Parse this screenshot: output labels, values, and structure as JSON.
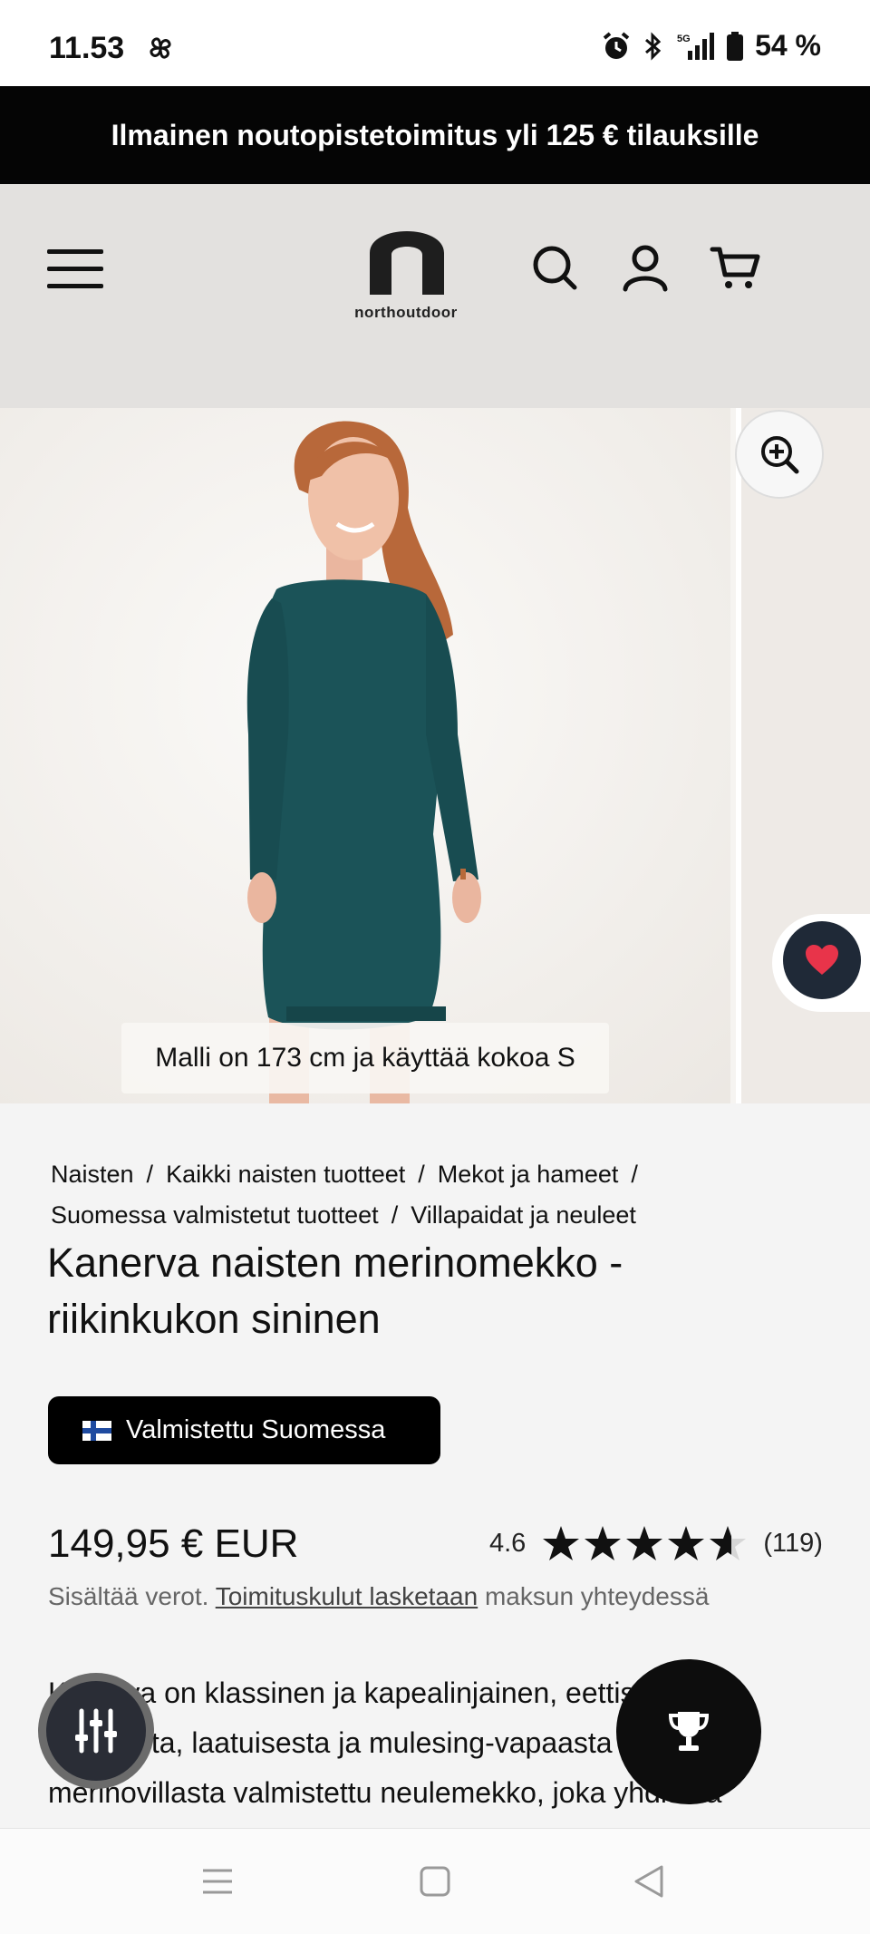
{
  "status_bar": {
    "time": "11.53",
    "network": "5G",
    "battery": "54 %",
    "icons": [
      "pinwheel-icon",
      "alarm-icon",
      "bluetooth-icon",
      "signal-icon",
      "battery-icon"
    ]
  },
  "promo_banner": {
    "text": "Ilmainen noutopistetoimitus yli 125 € tilauksille"
  },
  "header": {
    "logo_text": "northoutdoor",
    "icons": [
      "menu-icon",
      "search-icon",
      "account-icon",
      "cart-icon"
    ]
  },
  "gallery": {
    "caption": "Malli on 173 cm ja käyttää kokoa S",
    "dress_color": "#1b5358",
    "icons": [
      "zoom-in-icon",
      "heart-icon"
    ]
  },
  "breadcrumb": {
    "items": [
      "Naisten",
      "Kaikki naisten tuotteet",
      "Mekot ja hameet",
      "Suomessa valmistetut tuotteet",
      "Villapaidat ja neuleet"
    ]
  },
  "product": {
    "title_line1": "Kanerva naisten merinomekko -",
    "title_line2": "riikinkukon sininen",
    "badge": "Valmistettu Suomessa",
    "price": "149,95 € EUR",
    "rating_score": "4.6",
    "rating_stars": 4.6,
    "rating_count": "(119)",
    "tax_prefix": "Sisältää verot.",
    "tax_link": "Toimituskulut lasketaan",
    "tax_suffix": "maksun yhteydessä",
    "description_line1": "Kanerva on klassinen ja kapealinjainen, eettisesti",
    "description_line2": "tuotetusta, laatuisesta ja mulesing-vapaasta",
    "description_line3": "merinovillasta valmistettu neulemekko, joka yhdistää"
  },
  "fabs": {
    "icons": [
      "filter-sliders-icon",
      "trophy-icon"
    ]
  },
  "nav_bar": {
    "icons": [
      "recents-icon",
      "home-icon",
      "back-icon"
    ]
  },
  "colors": {
    "promo_bg": "#050505",
    "header_bg": "#e3e1df",
    "page_bg": "#f4f4f4",
    "heart": "#e8344a"
  }
}
